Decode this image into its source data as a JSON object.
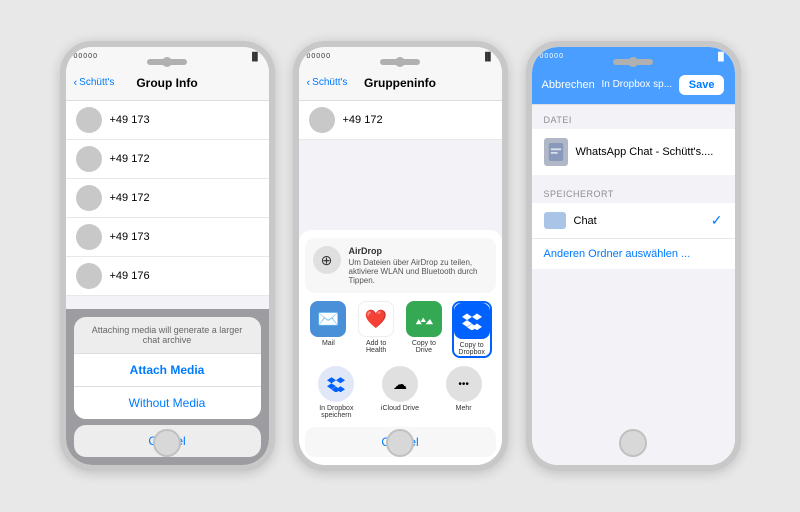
{
  "phone1": {
    "status": {
      "carrier": "00000",
      "wifi": "▲▼",
      "battery": "■■■"
    },
    "nav": {
      "back": "Schütt's",
      "title": "Group Info"
    },
    "contacts": [
      {
        "number": "+49 173"
      },
      {
        "number": "+49 172"
      },
      {
        "number": "+49 172"
      },
      {
        "number": "+49 173"
      },
      {
        "number": "+49 176"
      }
    ],
    "alert_message": "Attaching media will generate a larger chat archive",
    "attach_label": "Attach Media",
    "without_label": "Without Media",
    "cancel_label": "Cancel"
  },
  "phone2": {
    "status": {
      "carrier": "00000",
      "wifi": "▲▼",
      "battery": "■■■"
    },
    "nav": {
      "back": "Schütt's",
      "title": "Gruppeninfo"
    },
    "contact": {
      "number": "+49 172"
    },
    "airdrop_title": "AirDrop",
    "airdrop_desc": "Um Dateien über AirDrop zu teilen, aktiviere WLAN und Bluetooth durch Tippen.",
    "apps": [
      {
        "label": "Mail",
        "icon": "✉️",
        "bg": "#4a90d9"
      },
      {
        "label": "Add to Health",
        "icon": "❤️",
        "bg": "#fff"
      },
      {
        "label": "Copy to Drive",
        "icon": "△",
        "bg": "#34a853"
      },
      {
        "label": "Copy to Dropbox",
        "icon": "◈",
        "bg": "#0061ff"
      }
    ],
    "actions": [
      {
        "label": "In Dropbox speichern",
        "icon": "◈",
        "bg": "#e0e0e0"
      },
      {
        "label": "iCloud Drive",
        "icon": "☁",
        "bg": "#e0e0e0"
      },
      {
        "label": "Mehr",
        "icon": "•••",
        "bg": "#e0e0e0"
      }
    ],
    "cancel_label": "Cancel"
  },
  "phone3": {
    "status": {
      "carrier": "00000",
      "wifi": "▲▼",
      "battery": "■■■"
    },
    "header": {
      "cancel_label": "Abbrechen",
      "title": "In Dropbox sp...",
      "save_label": "Save"
    },
    "datei_section": "DATEI",
    "file_name": "WhatsApp Chat - Schütt's....",
    "speicherort_section": "SPEICHERORT",
    "chat_label": "Chat",
    "choose_folder_label": "Anderen Ordner auswählen ..."
  }
}
